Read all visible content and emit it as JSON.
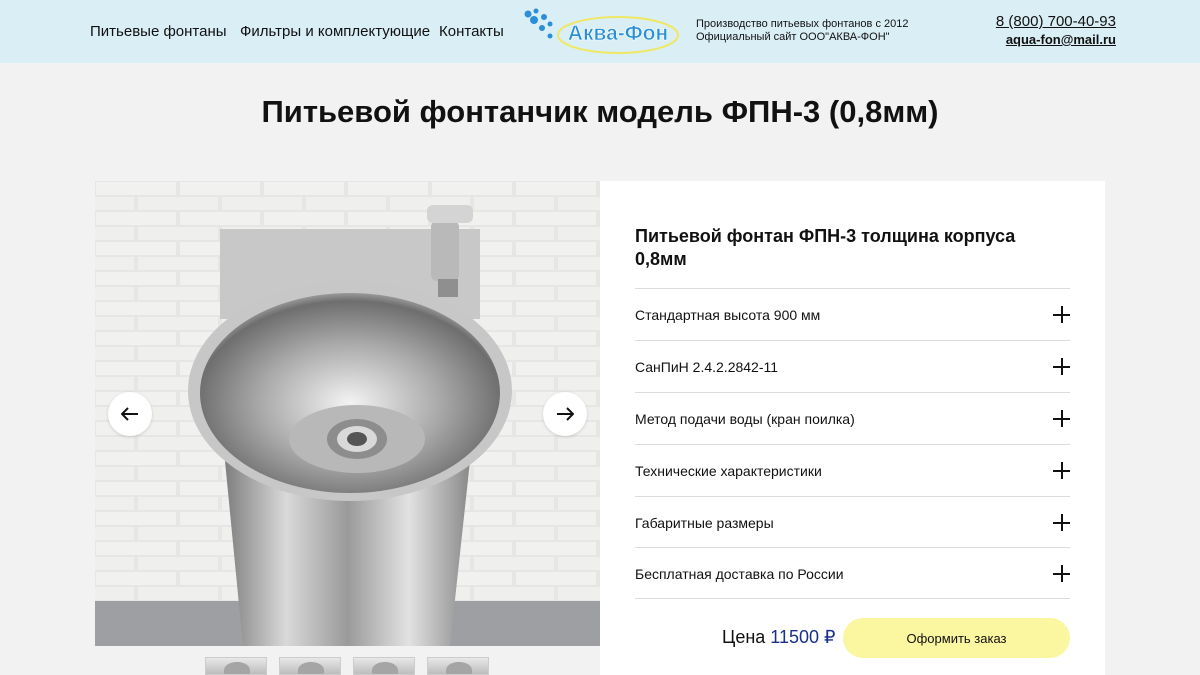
{
  "header": {
    "nav": [
      "Питьевые фонтаны",
      "Фильтры и комплектующие",
      "Контакты"
    ],
    "logo_text": "Аква-Фон",
    "tagline_1": "Производство питьевых фонтанов с 2012",
    "tagline_2": "Официальный сайт ООО\"АКВА-ФОН\"",
    "phone": "8 (800) 700-40-93",
    "email": "aqua-fon@mail.ru"
  },
  "page_title": "Питьевой фонтанчик модель ФПН-3 (0,8мм)",
  "product": {
    "title": "Питьевой фонтан ФПН-3 толщина корпуса 0,8мм",
    "accordion": [
      "Стандартная высота 900 мм",
      "СанПиН 2.4.2.2842-11",
      "Метод подачи воды (кран поилка)",
      "Технические характеристики",
      "Габаритные размеры",
      "Бесплатная доставка по России"
    ],
    "price_label": "Цена",
    "price_value": "11500",
    "currency": "₽",
    "order_button": "Оформить заказ"
  },
  "icons": {
    "prev": "arrow-left-icon",
    "next": "arrow-right-icon",
    "expand": "plus-icon"
  },
  "colors": {
    "header_bg": "#daeef6",
    "accent_button": "#fbf6a0",
    "price": "#1a2f8a",
    "logo_blue": "#2a8fd6"
  }
}
